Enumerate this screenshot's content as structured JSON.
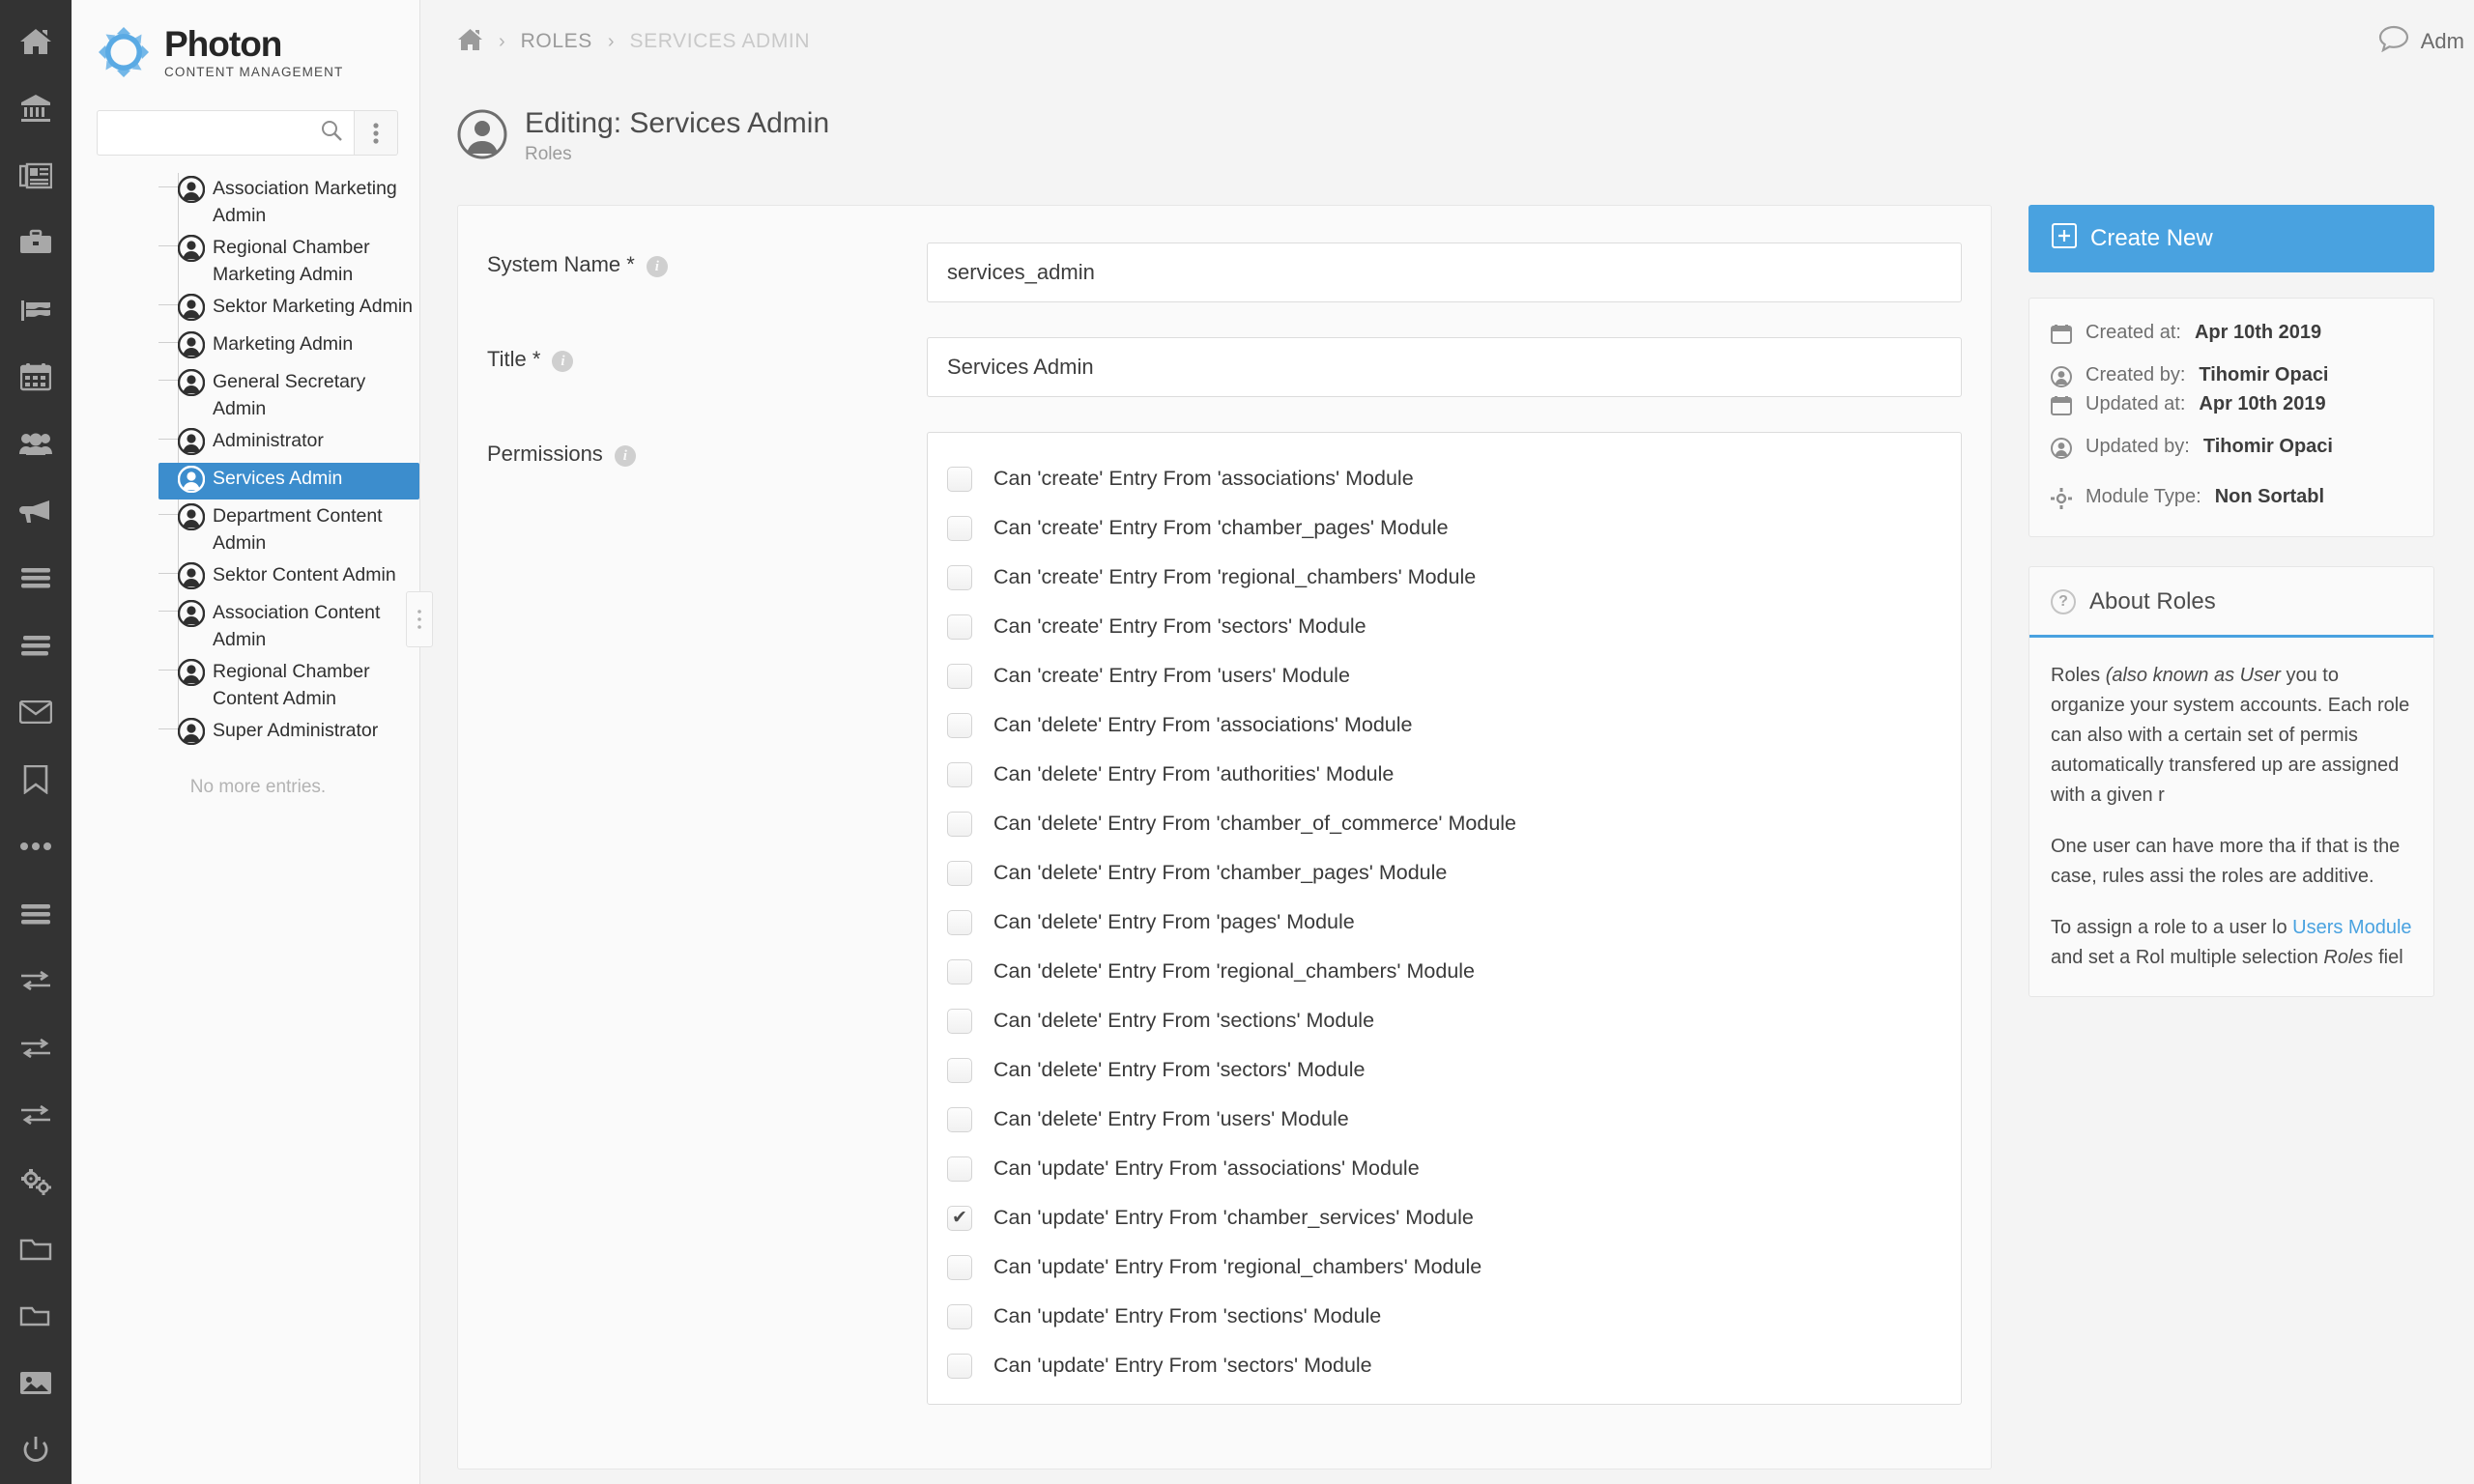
{
  "rail": {
    "items": [
      {
        "name": "home-icon",
        "label": "Home"
      },
      {
        "name": "bank-icon",
        "label": "Chambers"
      },
      {
        "name": "newspaper-icon",
        "label": "News"
      },
      {
        "name": "briefcase-icon",
        "label": "Business"
      },
      {
        "name": "flag-icon",
        "label": "Flags"
      },
      {
        "name": "calendar-icon",
        "label": "Calendar"
      },
      {
        "name": "users-icon",
        "label": "Users"
      },
      {
        "name": "megaphone-icon",
        "label": "Announcements"
      },
      {
        "name": "list-icon",
        "label": "Lists"
      },
      {
        "name": "list-alt-icon",
        "label": "Sections"
      },
      {
        "name": "envelope-icon",
        "label": "Messages"
      },
      {
        "name": "bookmark-icon",
        "label": "Bookmarks"
      },
      {
        "name": "ellipsis-icon",
        "label": "More"
      },
      {
        "name": "list-bars-icon",
        "label": "Modules"
      },
      {
        "name": "exchange-icon",
        "label": "Transfers"
      },
      {
        "name": "exchange-alt-icon",
        "label": "Sync"
      },
      {
        "name": "exchange-third-icon",
        "label": "Imports"
      },
      {
        "name": "cogs-icon",
        "label": "Settings"
      },
      {
        "name": "folder-icon",
        "label": "Files"
      },
      {
        "name": "folder-open-icon",
        "label": "Media Folders"
      },
      {
        "name": "image-icon",
        "label": "Images"
      },
      {
        "name": "power-icon",
        "label": "Logout"
      }
    ]
  },
  "brand": {
    "title": "Photon",
    "subtitle": "CONTENT MANAGEMENT"
  },
  "search": {
    "value": "",
    "placeholder": ""
  },
  "tree": {
    "items": [
      {
        "label": "Association Marketing Admin",
        "selected": false,
        "wrap": false
      },
      {
        "label": "Regional Chamber Marketing Admin",
        "selected": false,
        "wrap": true
      },
      {
        "label": "Sektor Marketing Admin",
        "selected": false,
        "wrap": false
      },
      {
        "label": "Marketing Admin",
        "selected": false,
        "wrap": false
      },
      {
        "label": "General Secretary Admin",
        "selected": false,
        "wrap": false
      },
      {
        "label": "Administrator",
        "selected": false,
        "wrap": false
      },
      {
        "label": "Services Admin",
        "selected": true,
        "wrap": false
      },
      {
        "label": "Department Content Admin",
        "selected": false,
        "wrap": false
      },
      {
        "label": "Sektor Content Admin",
        "selected": false,
        "wrap": false
      },
      {
        "label": "Association Content Admin",
        "selected": false,
        "wrap": false
      },
      {
        "label": "Regional Chamber Content Admin",
        "selected": false,
        "wrap": false
      },
      {
        "label": "Super Administrator",
        "selected": false,
        "wrap": false
      }
    ],
    "footer": "No more entries."
  },
  "breadcrumb": {
    "home": "home-icon",
    "items": [
      "ROLES",
      "SERVICES ADMIN"
    ],
    "separator": "›"
  },
  "topbar": {
    "chat_icon": "chat-icon",
    "admin_label": "Adm"
  },
  "page": {
    "title": "Editing: Services Admin",
    "subtitle": "Roles"
  },
  "form": {
    "system_name": {
      "label": "System Name *",
      "value": "services_admin"
    },
    "title": {
      "label": "Title *",
      "value": "Services Admin"
    },
    "permissions": {
      "label": "Permissions",
      "items": [
        {
          "label": "Can 'create' Entry From 'associations' Module",
          "checked": false
        },
        {
          "label": "Can 'create' Entry From 'chamber_pages' Module",
          "checked": false
        },
        {
          "label": "Can 'create' Entry From 'regional_chambers' Module",
          "checked": false
        },
        {
          "label": "Can 'create' Entry From 'sectors' Module",
          "checked": false
        },
        {
          "label": "Can 'create' Entry From 'users' Module",
          "checked": false
        },
        {
          "label": "Can 'delete' Entry From 'associations' Module",
          "checked": false
        },
        {
          "label": "Can 'delete' Entry From 'authorities' Module",
          "checked": false
        },
        {
          "label": "Can 'delete' Entry From 'chamber_of_commerce' Module",
          "checked": false
        },
        {
          "label": "Can 'delete' Entry From 'chamber_pages' Module",
          "checked": false
        },
        {
          "label": "Can 'delete' Entry From 'pages' Module",
          "checked": false
        },
        {
          "label": "Can 'delete' Entry From 'regional_chambers' Module",
          "checked": false
        },
        {
          "label": "Can 'delete' Entry From 'sections' Module",
          "checked": false
        },
        {
          "label": "Can 'delete' Entry From 'sectors' Module",
          "checked": false
        },
        {
          "label": "Can 'delete' Entry From 'users' Module",
          "checked": false
        },
        {
          "label": "Can 'update' Entry From 'associations' Module",
          "checked": false
        },
        {
          "label": "Can 'update' Entry From 'chamber_services' Module",
          "checked": true
        },
        {
          "label": "Can 'update' Entry From 'regional_chambers' Module",
          "checked": false
        },
        {
          "label": "Can 'update' Entry From 'sections' Module",
          "checked": false
        },
        {
          "label": "Can 'update' Entry From 'sectors' Module",
          "checked": false
        }
      ],
      "check_glyph": "✔"
    }
  },
  "sidebar": {
    "create_button": {
      "label": "Create New",
      "icon": "plus-square-icon"
    },
    "meta": [
      {
        "icon": "calendar-icon",
        "label": "Created at:",
        "value": "Apr 10th 2019"
      },
      {
        "icon": "user-icon",
        "label": "Created by:",
        "value": "Tihomir Opaci"
      },
      {
        "icon": "calendar-icon",
        "label": "Updated at:",
        "value": "Apr 10th 2019"
      },
      {
        "icon": "user-icon",
        "label": "Updated by:",
        "value": "Tihomir Opaci"
      }
    ],
    "module": {
      "icon": "gear-icon",
      "label": "Module Type:",
      "value": "Non Sortabl"
    },
    "about": {
      "icon": "question-icon",
      "title": "About Roles",
      "paragraphs": [
        {
          "parts": [
            {
              "t": "Roles ",
              "style": "normal"
            },
            {
              "t": "(also known as User ",
              "style": "italic"
            },
            {
              "t": "you to organize your system accounts. Each role can also with a certain set of permis automatically transfered up are assigned with a given r",
              "style": "normal"
            }
          ]
        },
        {
          "parts": [
            {
              "t": "One user can have more tha if that is the case, rules assi the roles are additive.",
              "style": "normal"
            }
          ]
        },
        {
          "parts": [
            {
              "t": "To assign a role to a user lo ",
              "style": "normal"
            },
            {
              "t": "Users Module",
              "style": "link"
            },
            {
              "t": " and set a Rol multiple selection ",
              "style": "normal"
            },
            {
              "t": "Roles",
              "style": "italic"
            },
            {
              "t": " fiel",
              "style": "normal"
            }
          ]
        }
      ]
    }
  },
  "colors": {
    "accent": "#49a2e0",
    "selection": "#3c8dcd",
    "rail_bg": "#333333",
    "rail_icon": "#a8a8a8"
  }
}
